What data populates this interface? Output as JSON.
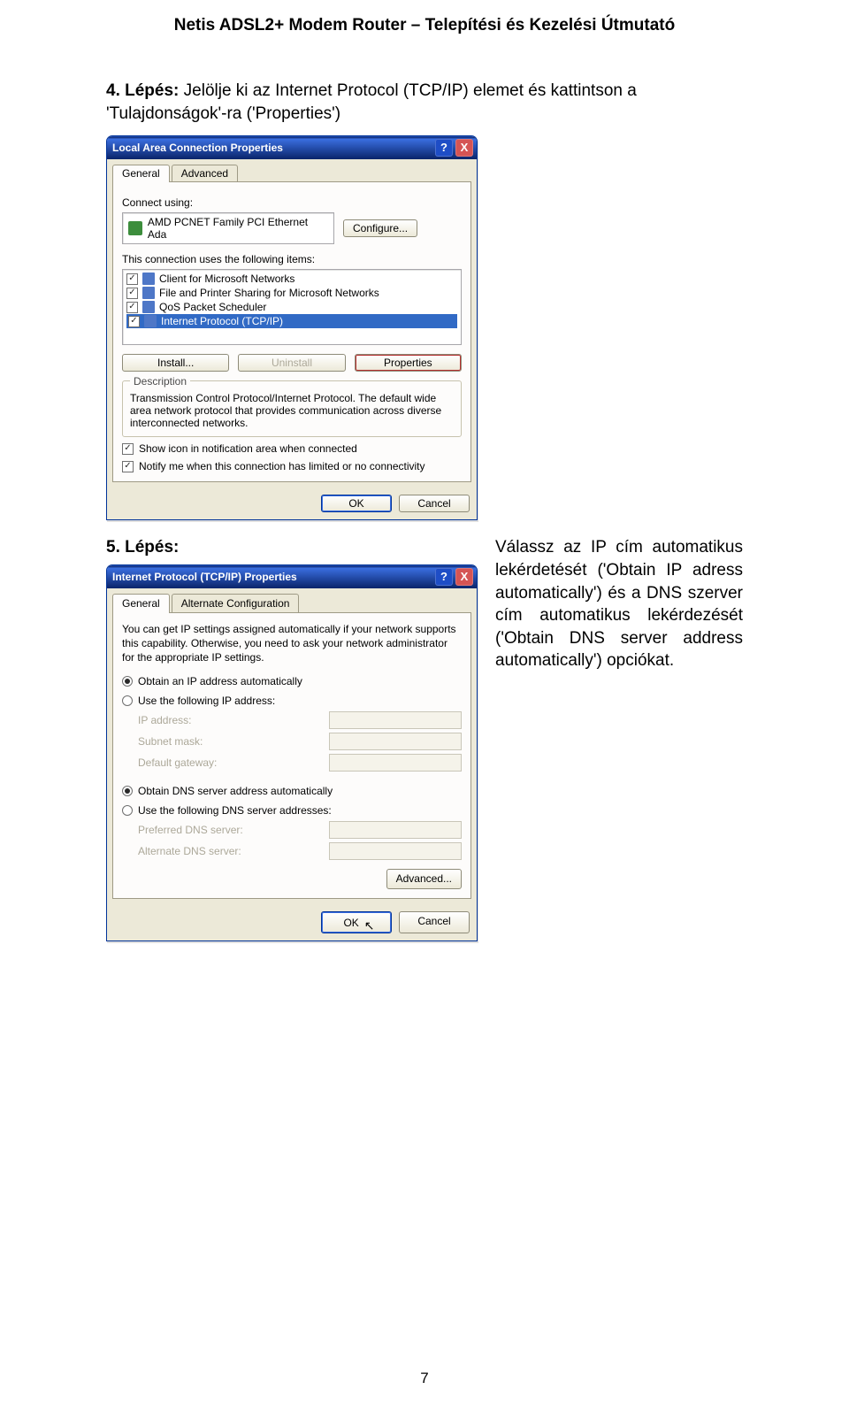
{
  "header": {
    "title": "Netis ADSL2+ Modem Router – Telepítési és Kezelési Útmutató"
  },
  "step4": {
    "prefix": "4. Lépés:",
    "text": " Jelölje ki az Internet Protocol (TCP/IP) elemet és kattintson a 'Tulajdonságok'-ra ('Properties')"
  },
  "dialog1": {
    "title": "Local Area Connection Properties",
    "helpGlyph": "?",
    "closeGlyph": "X",
    "tabs": {
      "general": "General",
      "advanced": "Advanced"
    },
    "connectUsing": "Connect using:",
    "adapter": "AMD PCNET Family PCI Ethernet Ada",
    "configure": "Configure...",
    "itemsHeader": "This connection uses the following items:",
    "items": [
      "Client for Microsoft Networks",
      "File and Printer Sharing for Microsoft Networks",
      "QoS Packet Scheduler",
      "Internet Protocol (TCP/IP)"
    ],
    "install": "Install...",
    "uninstall": "Uninstall",
    "properties": "Properties",
    "descLegend": "Description",
    "desc": "Transmission Control Protocol/Internet Protocol. The default wide area network protocol that provides communication across diverse interconnected networks.",
    "showIcon": "Show icon in notification area when connected",
    "notify": "Notify me when this connection has limited or no connectivity",
    "ok": "OK",
    "cancel": "Cancel"
  },
  "step5": {
    "prefix": "5. Lépés:",
    "line": " Válassz az IP cím automatikus lekérdetését ('Obtain IP adress automatically') és a DNS szerver cím automatikus lekérdezését ('Obtain DNS server address automatically') opciókat."
  },
  "dialog2": {
    "title": "Internet Protocol (TCP/IP) Properties",
    "helpGlyph": "?",
    "closeGlyph": "X",
    "tabs": {
      "general": "General",
      "alt": "Alternate Configuration"
    },
    "intro": "You can get IP settings assigned automatically if your network supports this capability. Otherwise, you need to ask your network administrator for the appropriate IP settings.",
    "obtainIp": "Obtain an IP address automatically",
    "useIp": "Use the following IP address:",
    "ipAddress": "IP address:",
    "subnet": "Subnet mask:",
    "gateway": "Default gateway:",
    "obtainDns": "Obtain DNS server address automatically",
    "useDns": "Use the following DNS server addresses:",
    "preferred": "Preferred DNS server:",
    "alternate": "Alternate DNS server:",
    "advanced": "Advanced...",
    "ok": "OK",
    "cancel": "Cancel"
  },
  "pageNumber": "7"
}
